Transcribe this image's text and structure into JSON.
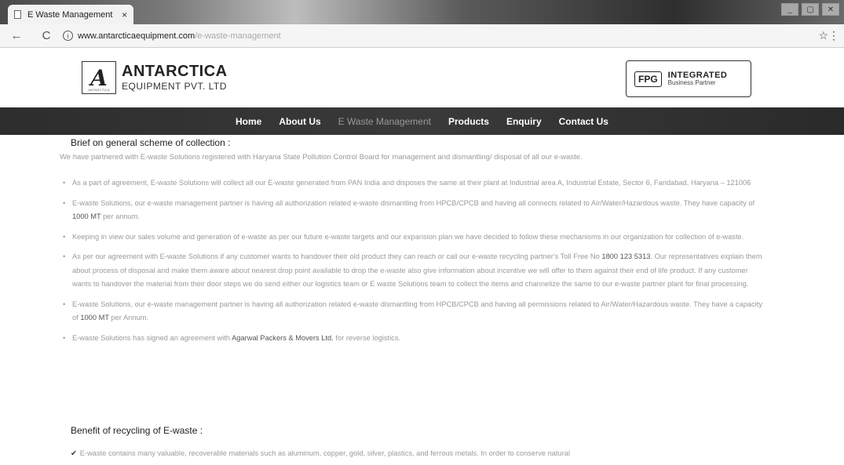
{
  "browser": {
    "tab_title": "E Waste Management",
    "tab_close": "×",
    "url_host": "www.antarcticaequipment.com",
    "url_path": "/e-waste-management",
    "window_controls": [
      "_",
      "▢",
      "✕"
    ]
  },
  "header": {
    "logo_glyph": "A",
    "logo_caption": "ANTARCTICA",
    "company_name": "ANTARCTICA",
    "company_sub": "EQUIPMENT PVT. LTD",
    "fpg_box": "FPG",
    "fpg_title": "INTEGRATED",
    "fpg_sub": "Business Partner"
  },
  "nav": [
    {
      "label": "Home",
      "active": false
    },
    {
      "label": "About Us",
      "active": false
    },
    {
      "label": "E Waste Management",
      "active": true
    },
    {
      "label": "Products",
      "active": false
    },
    {
      "label": "Enquiry",
      "active": false
    },
    {
      "label": "Contact Us",
      "active": false
    }
  ],
  "content": {
    "section1_title": "Brief on general scheme of collection :",
    "intro": "We have partnered with E-waste Solutions registered with Haryana State Pollution Control Board for management and dismantling/ disposal of all our e-waste.",
    "bullets": [
      {
        "text": "As a part of agreement, E-waste Solutions will collect all our E-waste generated from PAN India and disposes the same at their plant at Industrial area A, Industrial Estate, Sector 6, Faridabad, Haryana – 121006"
      },
      {
        "text_pre": "E-waste Solutions, our e-waste management partner is having all authorization related e-waste dismantling from HPCB/CPCB and having all connects related to Air/Water/Hazardous waste. They have capacity of ",
        "highlight": "1000 MT",
        "text_post": " per annum."
      },
      {
        "text": "Keeping in view our sales volume and generation of e-waste as per our future e-waste targets and our expansion plan we have decided to follow these mechanisms in our organization for collection of e-waste."
      },
      {
        "text_pre": "As per our agreement with E-waste Solutions if any customer wants to handover their old product they can reach or call our e-waste recycling partner's Toll Free No ",
        "highlight": "1800 123 5313",
        "text_post": ". Our representatives explain them about process of disposal and make them aware about nearest drop point available to drop the e-waste also give information about incentive we will offer to them against their end of life product. If any customer wants to handover the material from their door steps we do send either our logistics team or E waste Solutions team to collect the items and channelize the same to our e-waste partner plant for final processing."
      },
      {
        "text_pre": "E-waste Solutions, our e-waste management partner is having all authorization related e-waste dismantling from HPCB/CPCB and having all permissions related to Air/Water/Hazardous waste. They have a capacity of ",
        "highlight": "1000 MT",
        "text_post": " per Annum."
      },
      {
        "text_pre": "E-waste Solutions has signed an agreement with ",
        "highlight": "Agarwal Packers & Movers Ltd.",
        "text_post": " for reverse logistics."
      }
    ],
    "section2_title": "Benefit of recycling of E-waste :",
    "benefit_first": "E-waste contains many valuable, recoverable materials such as aluminum, copper, gold, silver, plastics, and ferrous metals. In order to conserve natural"
  }
}
